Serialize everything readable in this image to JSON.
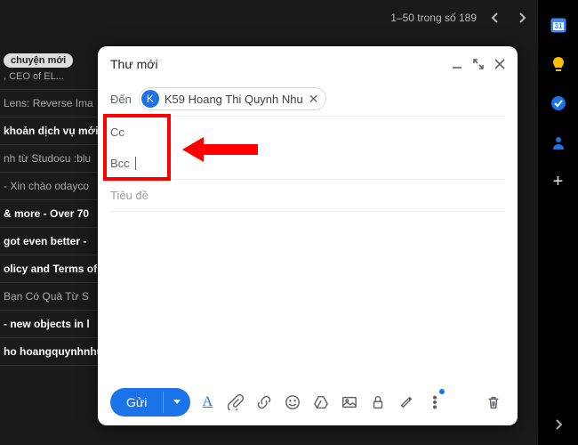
{
  "pagination": "1–50 trong số 189",
  "mail_list": [
    {
      "chip": "chuyện mới",
      "sub": ", CEO of EL..."
    },
    {
      "text": "Lens: Reverse Ima",
      "read": true
    },
    {
      "text": "khoản dịch vụ mới",
      "read": false
    },
    {
      "text": "nh từ Studocu :blu",
      "read": true
    },
    {
      "text": "- Xin chào odayco",
      "read": true
    },
    {
      "text": "& more - Over 70",
      "read": false
    },
    {
      "text": "got even better -",
      "read": false
    },
    {
      "text": "olicy and Terms of",
      "read": false
    },
    {
      "text": "Bạn Có Quà Từ S",
      "read": true
    },
    {
      "text": "- new objects in l",
      "read": false
    },
    {
      "text": "ho hoangquynhnhu",
      "read": false
    }
  ],
  "compose": {
    "title": "Thư mới",
    "to_label": "Đến",
    "recipient": {
      "initial": "K",
      "name": "K59 Hoang Thi Quynh Nhu"
    },
    "cc_label": "Cc",
    "bcc_label": "Bcc",
    "subject_placeholder": "Tiêu đề",
    "send_label": "Gửi"
  }
}
